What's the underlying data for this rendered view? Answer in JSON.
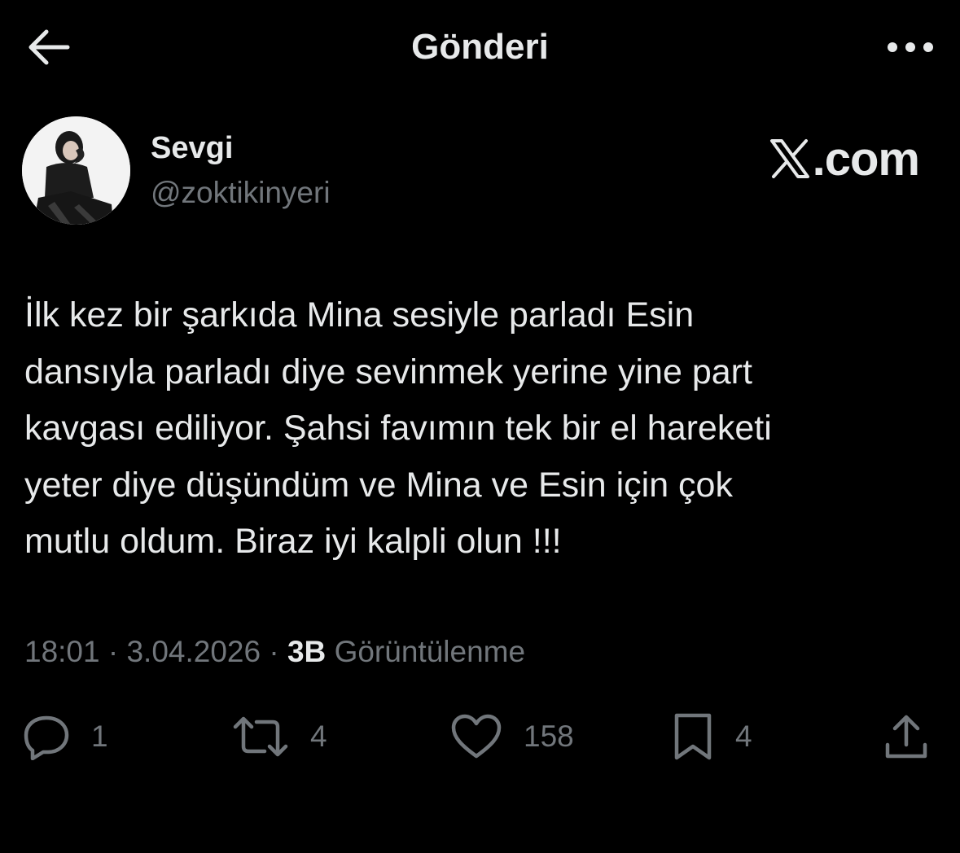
{
  "header": {
    "title": "Gönderi",
    "back_icon": "arrow-left-icon",
    "more_icon": "more-horizontal-icon"
  },
  "author": {
    "display_name": "Sevgi",
    "handle": "@zoktikinyeri"
  },
  "watermark": {
    "text": ".com"
  },
  "tweet": {
    "text": "İlk kez bir şarkıda Mina sesiyle parladı Esin\ndansıyla parladı diye sevinmek yerine yine part\nkavgası ediliyor. Şahsi favımın tek bir el hareketi\nyeter diye düşündüm ve Mina ve Esin için çok\nmutlu oldum. Biraz iyi kalpli olun !!!"
  },
  "meta": {
    "time": "18:01",
    "separator": " · ",
    "date": "3.04.2026",
    "views_count": "3B",
    "views_label": "Görüntülenme"
  },
  "actions": {
    "reply": {
      "icon": "reply-icon",
      "count": "1"
    },
    "retweet": {
      "icon": "retweet-icon",
      "count": "4"
    },
    "like": {
      "icon": "heart-icon",
      "count": "158"
    },
    "bookmark": {
      "icon": "bookmark-icon",
      "count": "4"
    },
    "share": {
      "icon": "share-icon"
    }
  },
  "colors": {
    "background": "#000000",
    "primary_text": "#e7e9ea",
    "secondary_text": "#71767b"
  }
}
